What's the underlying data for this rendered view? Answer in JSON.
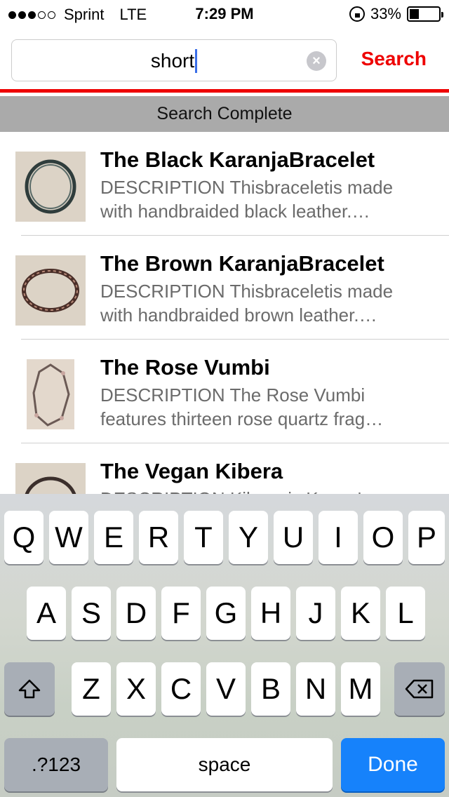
{
  "status_bar": {
    "carrier": "Sprint",
    "network": "LTE",
    "time": "7:29 PM",
    "battery_percent_label": "33%",
    "battery_level": 0.33,
    "signal_bars_filled": 3,
    "signal_bars_total": 5
  },
  "search": {
    "query": "short",
    "button_label": "Search"
  },
  "status_message": "Search Complete",
  "results": [
    {
      "title": "The Black KaranjaBracelet",
      "desc_line1": "DESCRIPTION Thisbraceletis made",
      "desc_line2": "with handbraided black leather.…"
    },
    {
      "title": "The Brown KaranjaBracelet",
      "desc_line1": "DESCRIPTION Thisbraceletis made",
      "desc_line2": "with handbraided brown leather.…"
    },
    {
      "title": "The Rose Vumbi",
      "desc_line1": "DESCRIPTION The Rose Vumbi",
      "desc_line2": "features thirteen rose quartz frag…"
    },
    {
      "title": "The Vegan Kibera",
      "desc_line1": "DESCRIPTION Kibera is Kenya's",
      "desc_line2": ""
    }
  ],
  "keyboard": {
    "row1": [
      "Q",
      "W",
      "E",
      "R",
      "T",
      "Y",
      "U",
      "I",
      "O",
      "P"
    ],
    "row2": [
      "A",
      "S",
      "D",
      "F",
      "G",
      "H",
      "J",
      "K",
      "L"
    ],
    "row3": [
      "Z",
      "X",
      "C",
      "V",
      "B",
      "N",
      "M"
    ],
    "numbers_label": ".?123",
    "space_label": "space",
    "done_label": "Done"
  },
  "colors": {
    "accent": "#ee0000",
    "done_key": "#1682fb",
    "status_strip": "#aaaaaa"
  },
  "icons": {
    "clear": "clear-icon",
    "shift": "shift-icon",
    "delete": "delete-icon",
    "lock": "rotation-lock-icon",
    "battery": "battery-icon"
  }
}
